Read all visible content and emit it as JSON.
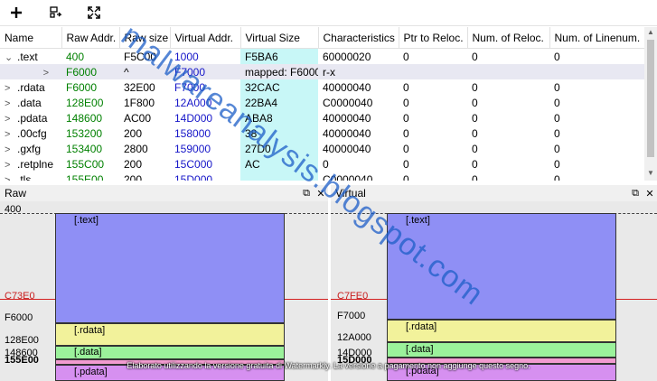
{
  "table": {
    "headers": [
      "Name",
      "Raw Addr.",
      "Raw size",
      "Virtual Addr.",
      "Virtual Size",
      "Characteristics",
      "Ptr to Reloc.",
      "Num. of Reloc.",
      "Num. of Linenum."
    ],
    "rows": [
      {
        "exp": "⌄",
        "name": ".text",
        "raw_addr": "400",
        "raw_size": "F5C00",
        "virt_addr": "1000",
        "virt_size": "F5BA6",
        "chars": "60000020",
        "ptr_reloc": "0",
        "num_reloc": "0",
        "num_lin": "0"
      },
      {
        "exp": ">",
        "name": "",
        "raw_addr": "F6000",
        "raw_size": "^",
        "virt_addr": "F7000",
        "virt_size": "mapped: F6000",
        "chars": "r-x",
        "ptr_reloc": "",
        "num_reloc": "",
        "num_lin": ""
      },
      {
        "exp": ">",
        "name": ".rdata",
        "raw_addr": "F6000",
        "raw_size": "32E00",
        "virt_addr": "F7000",
        "virt_size": "32CAC",
        "chars": "40000040",
        "ptr_reloc": "0",
        "num_reloc": "0",
        "num_lin": "0"
      },
      {
        "exp": ">",
        "name": ".data",
        "raw_addr": "128E00",
        "raw_size": "1F800",
        "virt_addr": "12A000",
        "virt_size": "22BA4",
        "chars": "C0000040",
        "ptr_reloc": "0",
        "num_reloc": "0",
        "num_lin": "0"
      },
      {
        "exp": ">",
        "name": ".pdata",
        "raw_addr": "148600",
        "raw_size": "AC00",
        "virt_addr": "14D000",
        "virt_size": "ABA8",
        "chars": "40000040",
        "ptr_reloc": "0",
        "num_reloc": "0",
        "num_lin": "0"
      },
      {
        "exp": ">",
        "name": ".00cfg",
        "raw_addr": "153200",
        "raw_size": "200",
        "virt_addr": "158000",
        "virt_size": "38",
        "chars": "40000040",
        "ptr_reloc": "0",
        "num_reloc": "0",
        "num_lin": "0"
      },
      {
        "exp": ">",
        "name": ".gxfg",
        "raw_addr": "153400",
        "raw_size": "2800",
        "virt_addr": "159000",
        "virt_size": "27D0",
        "chars": "40000040",
        "ptr_reloc": "0",
        "num_reloc": "0",
        "num_lin": "0"
      },
      {
        "exp": ">",
        "name": ".retplne",
        "raw_addr": "155C00",
        "raw_size": "200",
        "virt_addr": "15C000",
        "virt_size": "AC",
        "chars": "0",
        "ptr_reloc": "0",
        "num_reloc": "0",
        "num_lin": "0"
      },
      {
        "exp": ">",
        "name": ".tls",
        "raw_addr": "155E00",
        "raw_size": "200",
        "virt_addr": "15D000",
        "virt_size": "",
        "chars": "C0000040",
        "ptr_reloc": "0",
        "num_reloc": "0",
        "num_lin": "0"
      }
    ]
  },
  "raw_pane": {
    "title": "Raw",
    "top_label": "400",
    "marker_label": "C73E0",
    "labels": {
      "f6000": "F6000",
      "data": "128E00",
      "pdata": "148600",
      "tail": "155E00"
    },
    "sections": {
      "text": "[.text]",
      "rdata": "[.rdata]",
      "data": "[.data]",
      "pdata": "[.pdata]"
    }
  },
  "virtual_pane": {
    "title": "Virtual",
    "top_label": "",
    "marker_label": "C7FE0",
    "labels": {
      "f7000": "F7000",
      "data": "12A000",
      "pdata": "14D000",
      "tail": "15D000"
    },
    "sections": {
      "text": "[.text]",
      "rdata": "[.rdata]",
      "data": "[.data]",
      "pdata": "[.pdata]"
    }
  },
  "watermark": "malwareanalysis.blogspot.com",
  "banner": "Elaborato utilizzando la versione gratuita di Watermarkly. La versione a pagamento non aggiunge questo segno.",
  "colors": {
    "text": "#8f8ff5",
    "rdata": "#f2f29b",
    "data": "#9bf29b",
    "pdata": "#f29bd0",
    "tail": "#d690f0"
  }
}
